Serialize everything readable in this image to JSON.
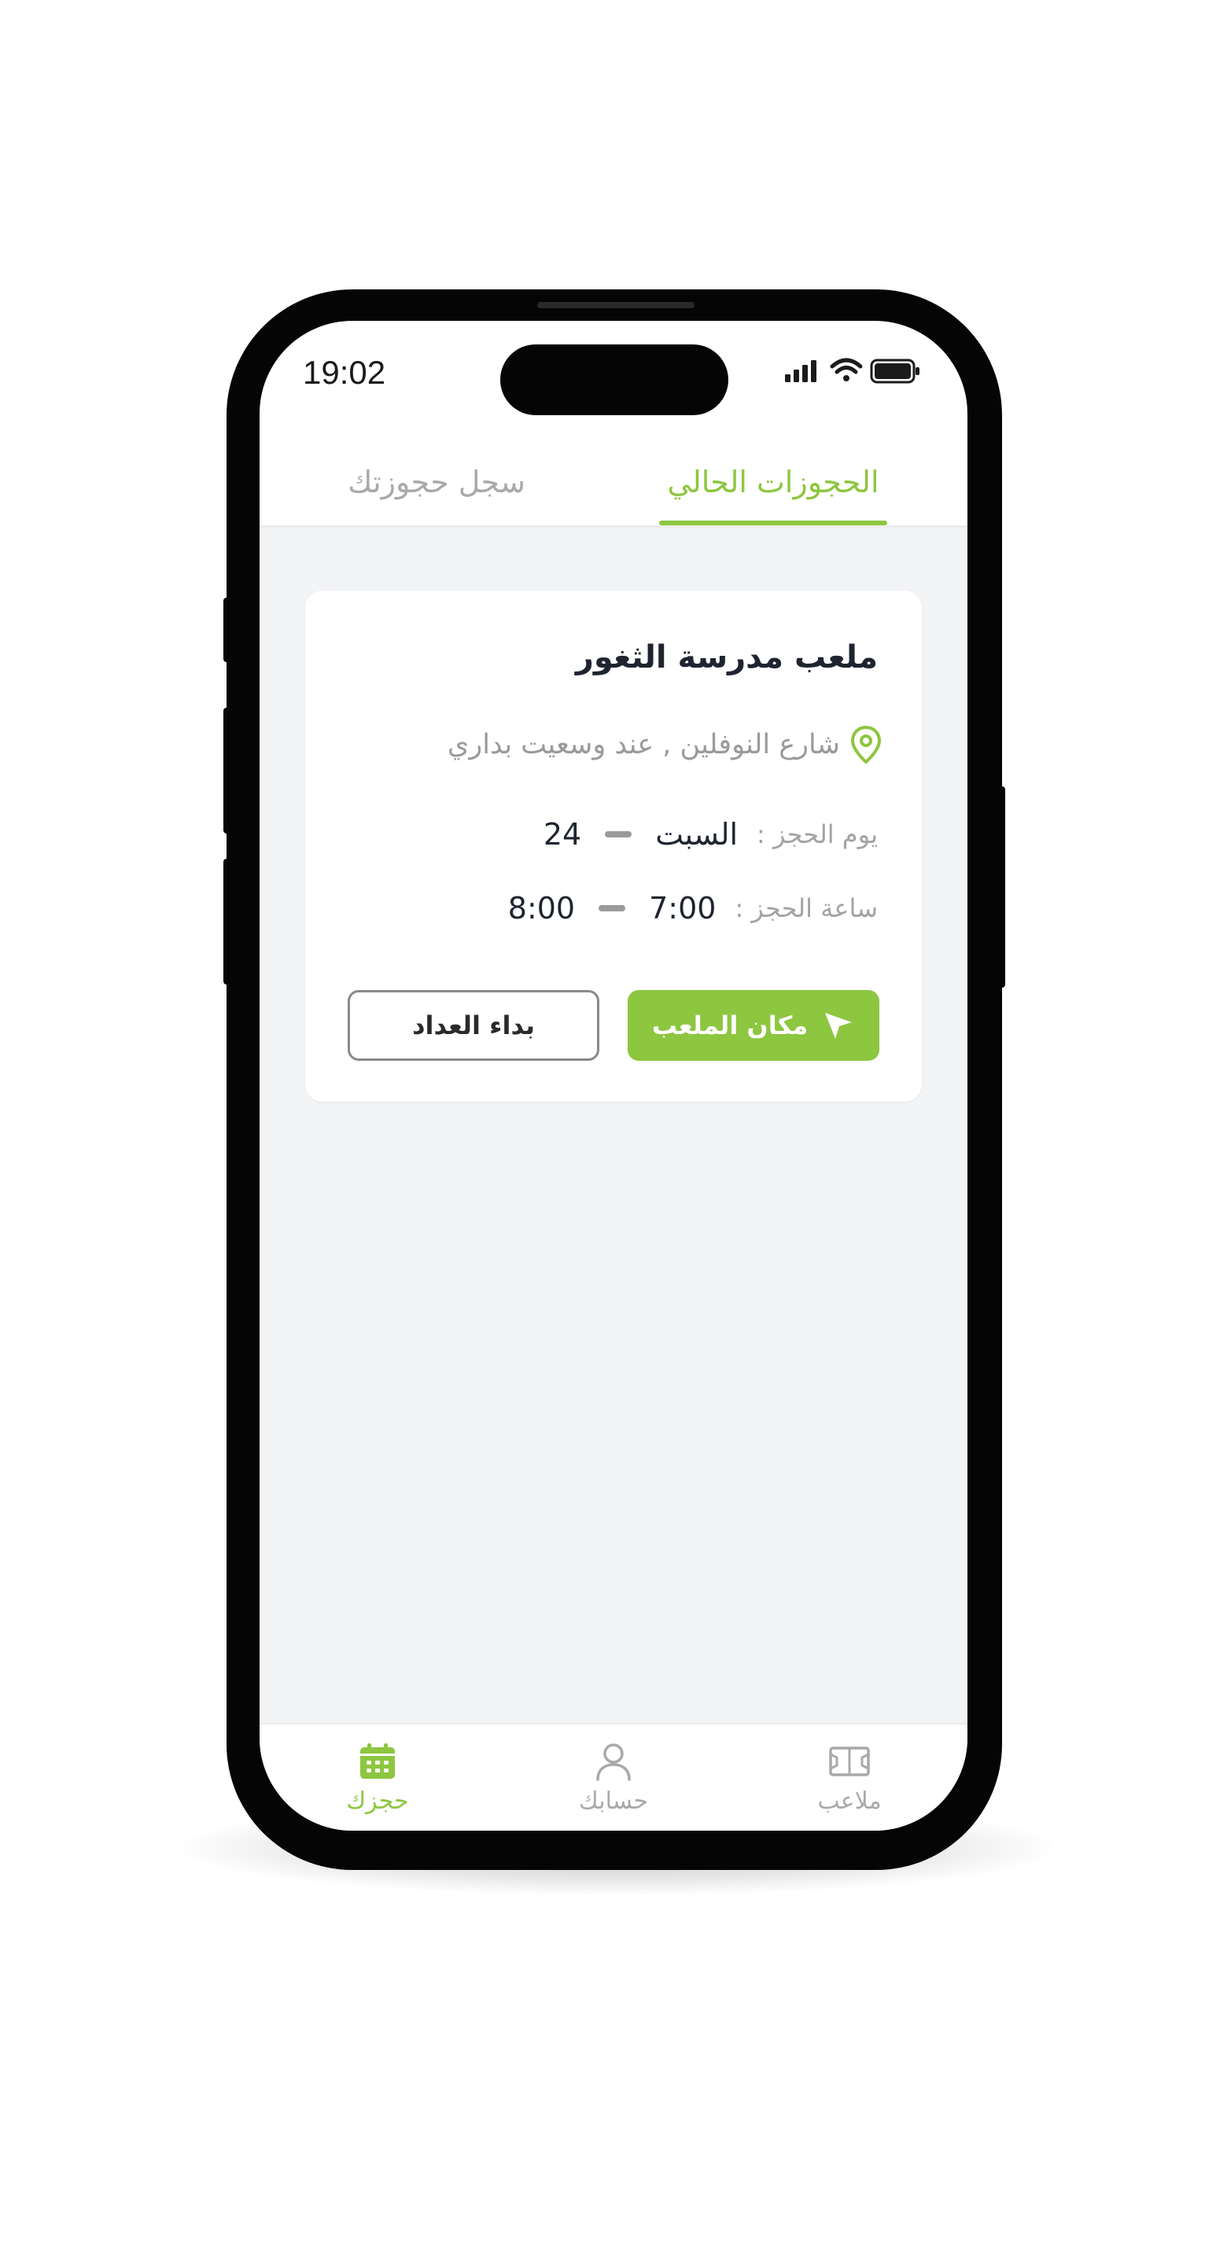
{
  "status_bar": {
    "time": "19:02",
    "icons": [
      "signal-icon",
      "wifi-icon",
      "battery-icon"
    ]
  },
  "tabs": [
    {
      "label": "الحجوزات الحالي",
      "active": true
    },
    {
      "label": "سجل حجوزتك",
      "active": false
    }
  ],
  "booking_card": {
    "title": "ملعب مدرسة الثغور",
    "address": "شارع النوفلين , عند وسعيت بداري",
    "day_label": "يوم الحجز :",
    "day_name": "السبت",
    "day_number": "24",
    "time_label": "ساعة الحجز :",
    "time_start": "7:00",
    "time_end": "8:00",
    "location_button": "مكان الملعب",
    "start_button": "بداء العداد"
  },
  "bottom_nav": [
    {
      "label": "حجزك",
      "icon": "calendar-icon",
      "active": true
    },
    {
      "label": "حسابك",
      "icon": "user-icon",
      "active": false
    },
    {
      "label": "ملاعب",
      "icon": "field-icon",
      "active": false
    }
  ],
  "colors": {
    "accent": "#8dc63f",
    "text_dark": "#1f2430",
    "text_muted": "#a9a9a9",
    "content_bg": "#f3f4f6"
  }
}
